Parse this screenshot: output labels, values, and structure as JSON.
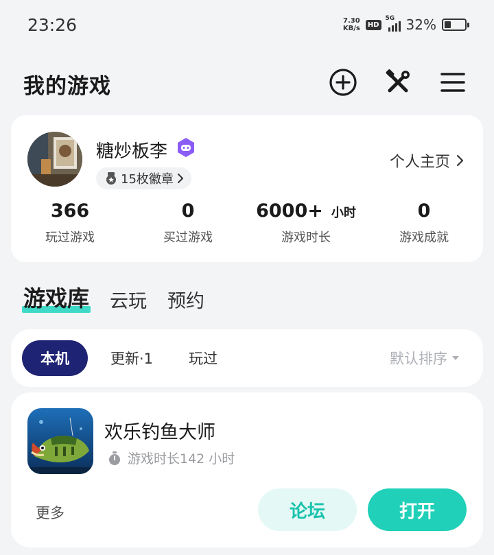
{
  "status_bar": {
    "time": "23:26",
    "net_speed_value": "7.30",
    "net_speed_unit": "KB/s",
    "hd_label": "HD",
    "signal_label": "5G",
    "battery_percent": "32%",
    "battery_level": 0.32
  },
  "header": {
    "title": "我的游戏",
    "icons": [
      "add-circle-icon",
      "tools-icon",
      "menu-icon"
    ]
  },
  "profile": {
    "username": "糖炒板李",
    "badges_label": "15枚徽章",
    "homepage_label": "个人主页",
    "stats": [
      {
        "value": "366",
        "unit": "",
        "label": "玩过游戏"
      },
      {
        "value": "0",
        "unit": "",
        "label": "买过游戏"
      },
      {
        "value": "6000+",
        "unit": "小时",
        "label": "游戏时长"
      },
      {
        "value": "0",
        "unit": "",
        "label": "游戏成就"
      }
    ]
  },
  "main_tabs": [
    {
      "label": "游戏库",
      "active": true
    },
    {
      "label": "云玩",
      "active": false
    },
    {
      "label": "预约",
      "active": false
    }
  ],
  "filters": {
    "chips": [
      {
        "label": "本机",
        "active": true
      },
      {
        "label": "更新·1",
        "active": false
      },
      {
        "label": "玩过",
        "active": false
      }
    ],
    "sort_label": "默认排序"
  },
  "game": {
    "name": "欢乐钓鱼大师",
    "playtime": "游戏时长142 小时",
    "more_label": "更多",
    "forum_label": "论坛",
    "open_label": "打开"
  },
  "colors": {
    "accent": "#20d0b8",
    "accent_light": "#e4f8f5",
    "active_chip": "#1f2374",
    "vip": "#8b5cf6"
  }
}
